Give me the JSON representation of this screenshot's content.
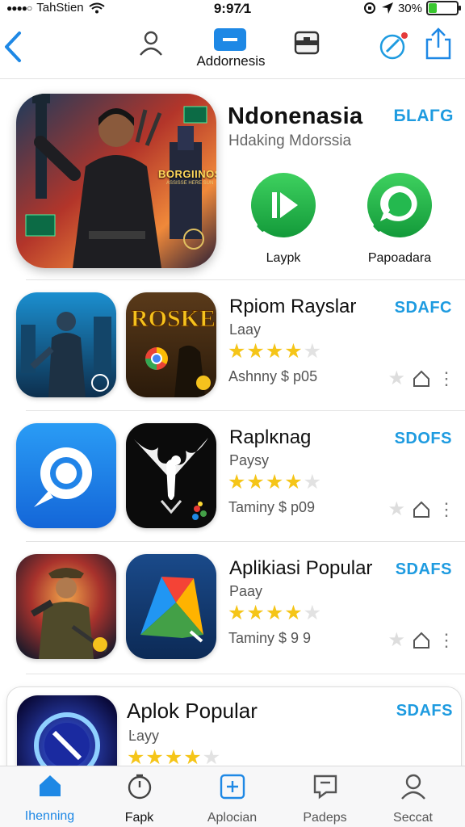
{
  "status_bar": {
    "carrier": "TahStien",
    "time": "9:97⁄1",
    "battery": "30%",
    "battery_level": 0.3
  },
  "nav": {
    "title": "Addornesis",
    "icons": [
      "back-chevron-icon",
      "profile-icon",
      "center-app-icon",
      "briefcase-icon",
      "edit-notification-icon",
      "share-icon"
    ]
  },
  "featured": {
    "title": "Ndonenasia",
    "subtitle": "Hdaking Mdorssia",
    "badge": "БLAΓG",
    "hero_text": "BORGIINOS",
    "hero_subtext": "ASSISSE HERE SUN",
    "apps": [
      {
        "label": "Laypk",
        "icon": "play-icon",
        "color": "#1fb34a"
      },
      {
        "label": "Papoadara",
        "icon": "chat-bubble-icon",
        "color": "#1fb34a"
      }
    ]
  },
  "rows": [
    {
      "title": "Rpiom Rayslar",
      "subtitle": "Laay",
      "badge": "SDAFC",
      "rating": 3.5,
      "stars": "★★★★★",
      "price": "Ashnny $ p05",
      "tile1_text": "",
      "tile2_text": "ROSKEA"
    },
    {
      "title": "Raplκnag",
      "subtitle": "Paysy",
      "badge": "SDOFS",
      "rating": 3.5,
      "stars": "★★★★★",
      "price": "Taminy $ p09"
    },
    {
      "title": "Aplikiasi Popular",
      "subtitle": "Paay",
      "badge": "SDAFS",
      "rating": 4,
      "stars": "★★★★★",
      "price": "Taminy $ 9 9"
    }
  ],
  "last_card": {
    "title": "Aplok  Popular",
    "subtitle": "Ŀayy",
    "badge": "SDAFS",
    "rating": 4,
    "stars": "★★★★★"
  },
  "tabs": [
    {
      "label": "Ihenning",
      "icon": "home-icon",
      "active": true
    },
    {
      "label": "Fapk",
      "icon": "timer-icon",
      "active": false
    },
    {
      "label": "Aplocian",
      "icon": "add-square-icon",
      "active": false
    },
    {
      "label": "Padeps",
      "icon": "message-icon",
      "active": false
    },
    {
      "label": "Seccat",
      "icon": "person-icon",
      "active": false
    }
  ],
  "colors": {
    "accent": "#1e9be0",
    "tab_active": "#1e88e5",
    "star": "#f5c518",
    "green": "#1fb34a"
  }
}
